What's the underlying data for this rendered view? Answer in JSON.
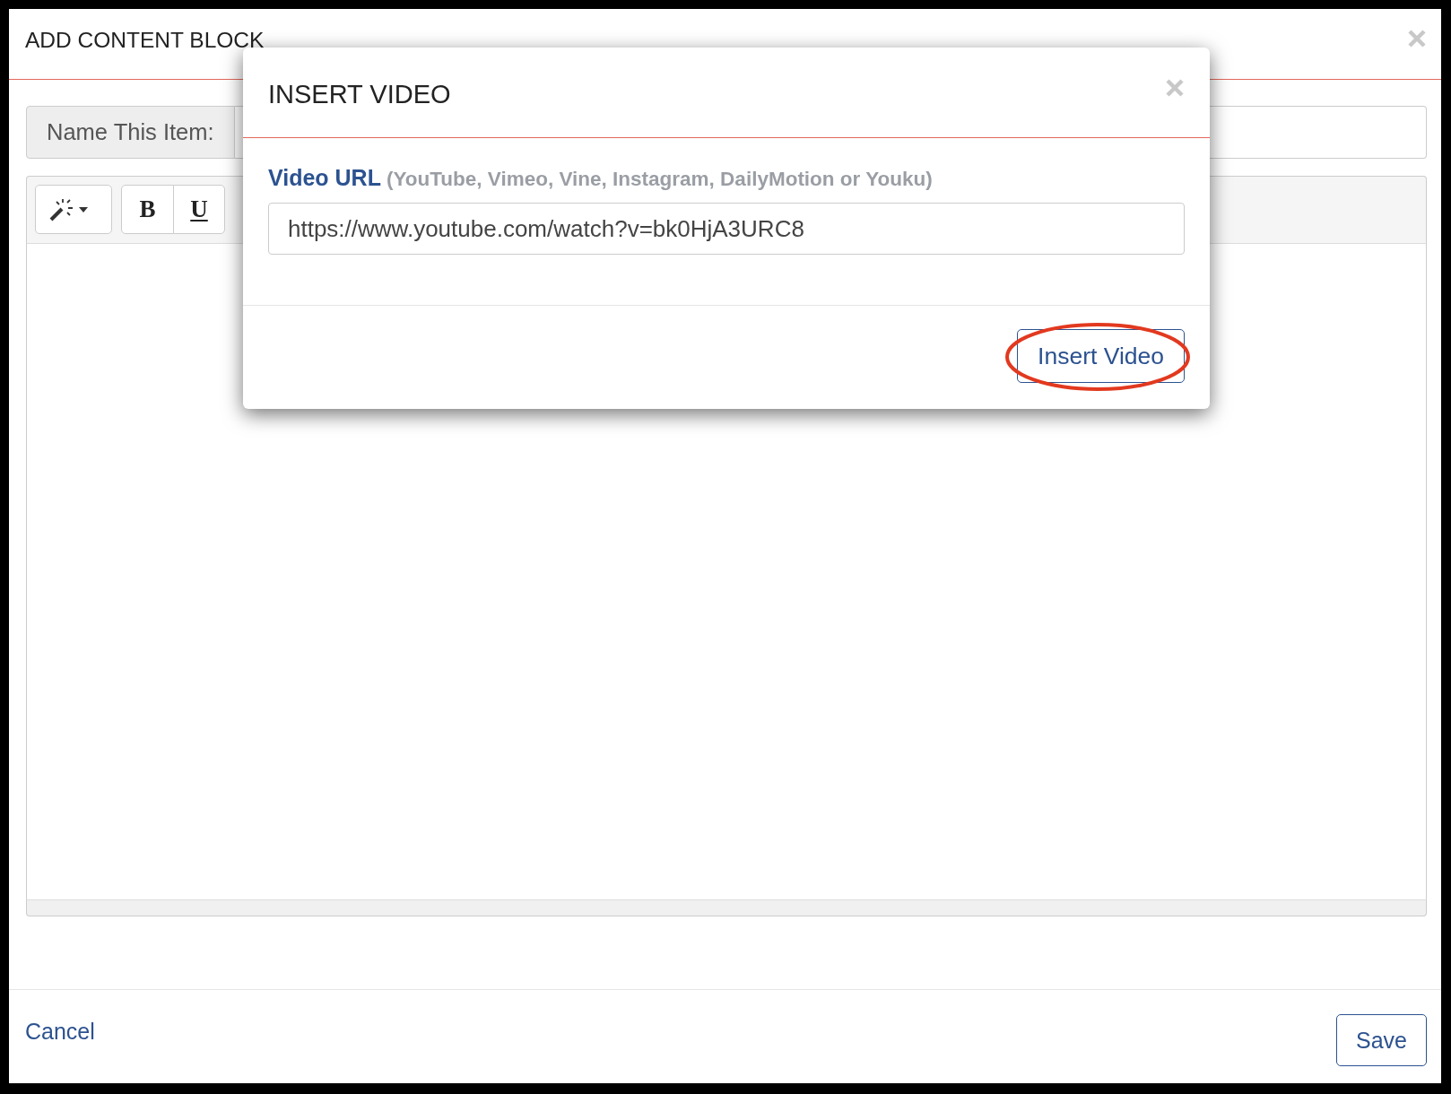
{
  "dialog": {
    "title": "ADD CONTENT BLOCK",
    "name_field": {
      "label": "Name This Item:"
    },
    "editor": {
      "toolbar": [
        {
          "buttons": [
            {
              "kind": "style_menu"
            }
          ]
        },
        {
          "buttons": [
            {
              "kind": "bold",
              "label": "B"
            },
            {
              "kind": "underline",
              "label": "U"
            }
          ]
        }
      ]
    },
    "footer": {
      "cancel": "Cancel",
      "save": "Save"
    }
  },
  "modal": {
    "title": "INSERT VIDEO",
    "field": {
      "label": "Video URL",
      "hint": "(YouTube, Vimeo, Vine, Instagram, DailyMotion or Youku)",
      "value": "https://www.youtube.com/watch?v=bk0HjA3URC8"
    },
    "button": {
      "label": "Insert Video",
      "circled": true
    }
  }
}
